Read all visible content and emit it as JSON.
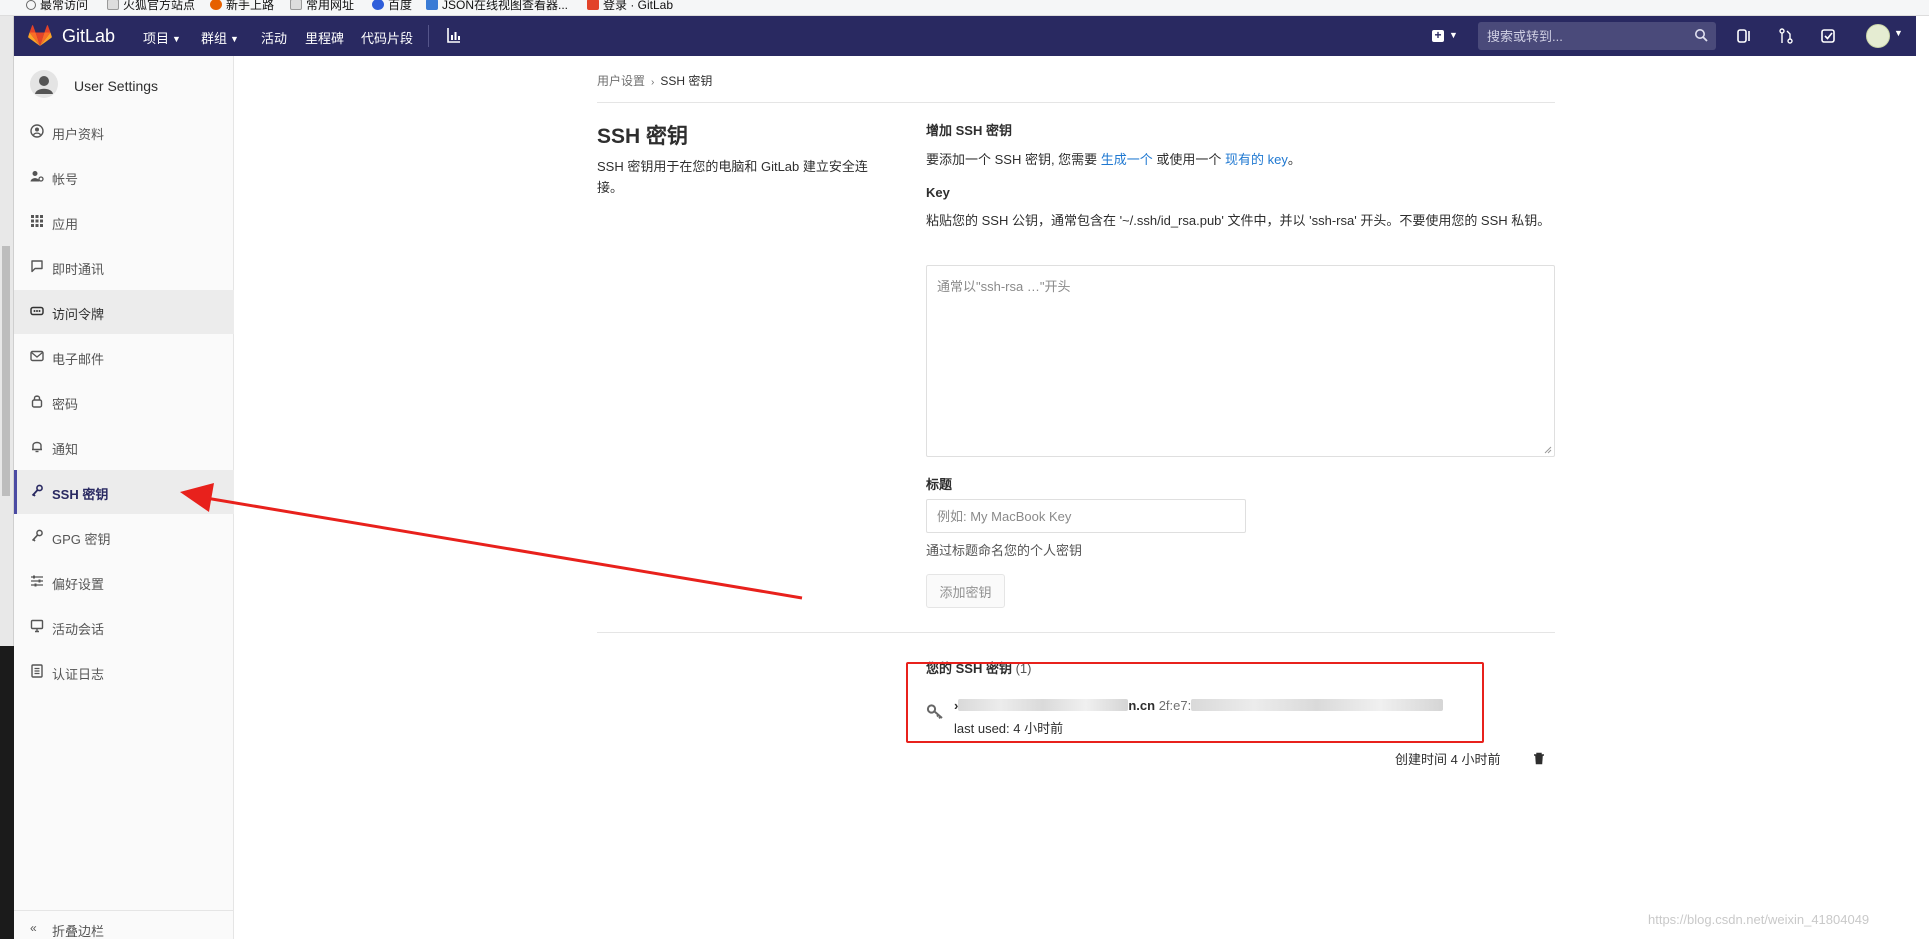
{
  "bookmarks": [
    {
      "label": "最常访问",
      "icon_color": "#666666"
    },
    {
      "label": "火狐官方站点",
      "icon_color": "#999999"
    },
    {
      "label": "新手上路",
      "icon_color": "#e66000"
    },
    {
      "label": "常用网址",
      "icon_color": "#999999"
    },
    {
      "label": "百度",
      "icon_color": "#2f5eda"
    },
    {
      "label": "JSON在线视图查看器...",
      "icon_color": "#3a7bd5"
    },
    {
      "label": "登录 · GitLab",
      "icon_color": "#e24329"
    }
  ],
  "navbar": {
    "brand": "GitLab",
    "items": [
      "项目",
      "群组",
      "活动",
      "里程碑",
      "代码片段"
    ],
    "search_placeholder": "搜索或转到...",
    "bg_color": "#292961"
  },
  "sidebar": {
    "title": "User Settings",
    "items": [
      {
        "label": "用户资料",
        "icon": "profile-icon"
      },
      {
        "label": "帐号",
        "icon": "account-icon"
      },
      {
        "label": "应用",
        "icon": "applications-icon"
      },
      {
        "label": "即时通讯",
        "icon": "chat-icon"
      },
      {
        "label": "访问令牌",
        "icon": "token-icon"
      },
      {
        "label": "电子邮件",
        "icon": "email-icon"
      },
      {
        "label": "密码",
        "icon": "lock-icon"
      },
      {
        "label": "通知",
        "icon": "notification-icon"
      },
      {
        "label": "SSH 密钥",
        "icon": "key-icon"
      },
      {
        "label": "GPG 密钥",
        "icon": "key-icon"
      },
      {
        "label": "偏好设置",
        "icon": "preferences-icon"
      },
      {
        "label": "活动会话",
        "icon": "sessions-icon"
      },
      {
        "label": "认证日志",
        "icon": "log-icon"
      }
    ],
    "collapse_label": "折叠边栏"
  },
  "breadcrumb": {
    "parent": "用户设置",
    "current": "SSH 密钥"
  },
  "section": {
    "title": "SSH 密钥",
    "description": "SSH 密钥用于在您的电脑和 GitLab 建立安全连接。"
  },
  "add_form": {
    "heading": "增加 SSH 密钥",
    "intro_prefix": "要添加一个 SSH 密钥, 您需要 ",
    "generate_link": "生成一个",
    "intro_middle": " 或使用一个 ",
    "existing_link": "现有的 key",
    "intro_suffix": "。",
    "key_label": "Key",
    "key_help": "粘贴您的 SSH 公钥，通常包含在 '~/.ssh/id_rsa.pub' 文件中，并以 'ssh-rsa' 开头。不要使用您的 SSH 私钥。",
    "key_placeholder": "通常以\"ssh-rsa …\"开头",
    "title_label": "标题",
    "title_placeholder": "例如: My MacBook Key",
    "title_help": "通过标题命名您的个人密钥",
    "add_button": "添加密钥"
  },
  "keys_list": {
    "heading": "您的 SSH 密钥",
    "count": "(1)",
    "keys": [
      {
        "title_visible": "n.cn",
        "fingerprint_prefix": "2f:e7:",
        "last_used": "last used: 4 小时前",
        "created": "创建时间 4 小时前"
      }
    ]
  },
  "annotation": {
    "color": "#e8211c"
  },
  "watermark": "https://blog.csdn.net/weixin_41804049"
}
